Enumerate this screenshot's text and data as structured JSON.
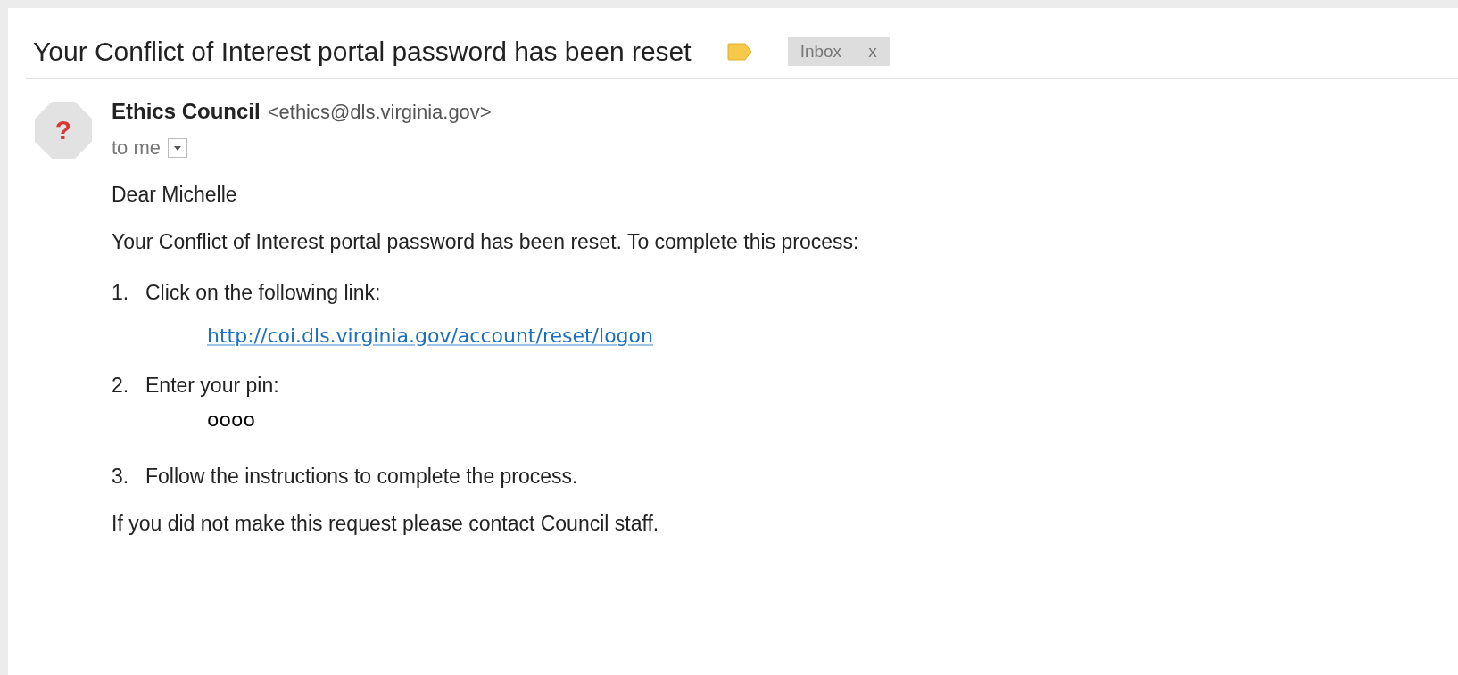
{
  "subject": "Your Conflict of Interest portal password has been reset",
  "label_chip": {
    "label": "Inbox",
    "close": "x"
  },
  "sender": {
    "name": "Ethics Council",
    "email": "<ethics@dls.virginia.gov>",
    "avatar": "?"
  },
  "recipient": "to me",
  "body": {
    "greeting": "Dear Michelle",
    "intro": "Your Conflict of Interest portal password has been reset. To complete this process:",
    "steps": [
      {
        "number": "1.",
        "text": "Click on the following link:",
        "detail": {
          "kind": "link",
          "text": "http://coi.dls.virginia.gov/account/reset/logon"
        }
      },
      {
        "number": "2.",
        "text": "Enter your pin:",
        "detail": {
          "kind": "value",
          "text": "oooo"
        }
      },
      {
        "number": "3.",
        "text": "Follow the instructions to complete the process."
      }
    ],
    "closing": "If you did not make this request please contact Council staff."
  }
}
